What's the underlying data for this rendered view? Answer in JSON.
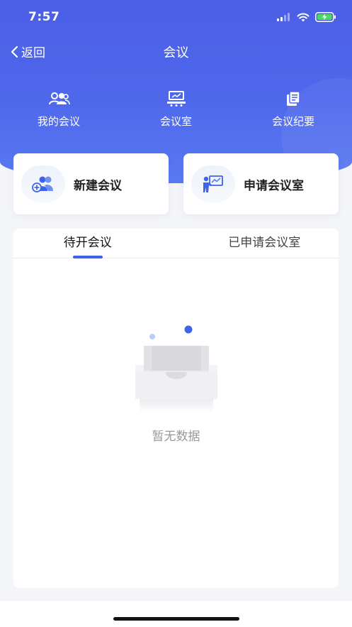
{
  "status_bar": {
    "time": "7:57"
  },
  "nav": {
    "back_label": "返回",
    "title": "会议"
  },
  "quick_items": [
    {
      "label": "我的会议",
      "icon": "people-group-icon"
    },
    {
      "label": "会议室",
      "icon": "meeting-room-icon"
    },
    {
      "label": "会议纪要",
      "icon": "document-icon"
    }
  ],
  "cards": [
    {
      "label": "新建会议",
      "icon": "add-meeting-icon"
    },
    {
      "label": "申请会议室",
      "icon": "presentation-icon"
    }
  ],
  "tabs": [
    {
      "label": "待开会议",
      "active": true
    },
    {
      "label": "已申请会议室",
      "active": false
    }
  ],
  "empty_state": {
    "text": "暂无数据",
    "icon": "empty-box-icon"
  },
  "colors": {
    "accent": "#4c5fe6",
    "tab_indicator": "#3f63e6"
  }
}
